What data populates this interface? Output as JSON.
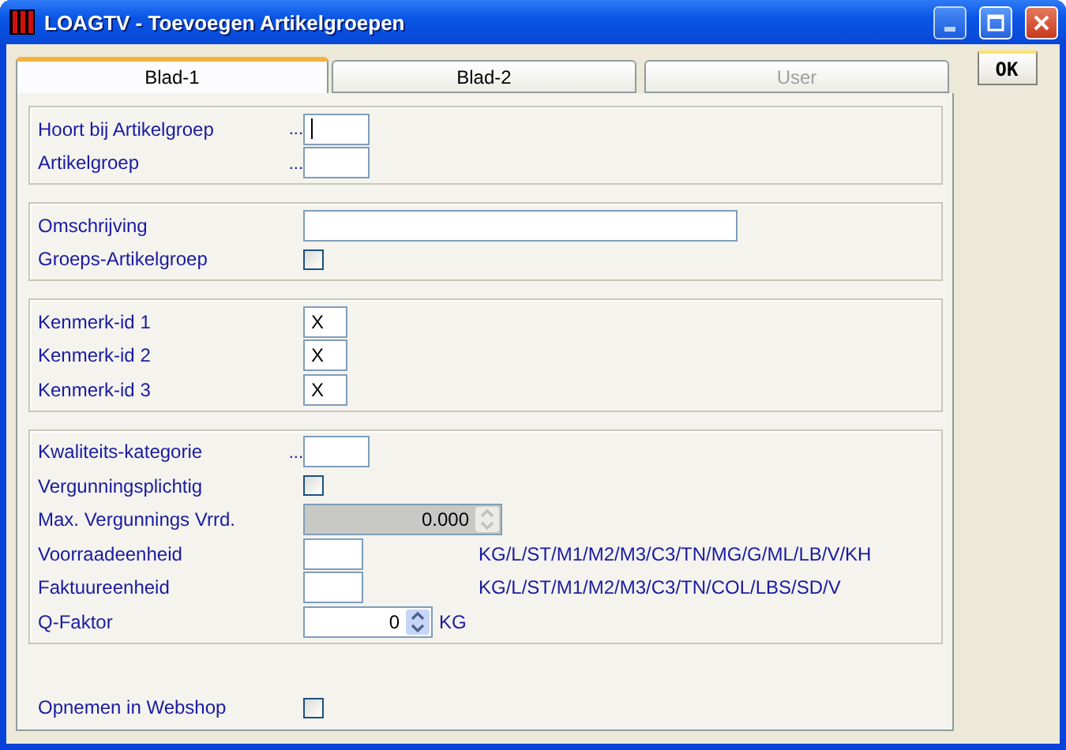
{
  "window": {
    "title": "LOAGTV - Toevoegen Artikelgroepen"
  },
  "tabs": [
    {
      "label": "Blad-1",
      "selected": true,
      "disabled": false
    },
    {
      "label": "Blad-2",
      "selected": false,
      "disabled": false
    },
    {
      "label": "User",
      "selected": false,
      "disabled": true
    }
  ],
  "ok_button": "OK",
  "sections": [
    {
      "framed": true,
      "rows": [
        {
          "kind": "lookup",
          "label": "Hoort bij Artikelgroep",
          "dots": "...",
          "focused": true
        },
        {
          "kind": "lookup",
          "label": "Artikelgroep",
          "dots": "...",
          "focused": false
        }
      ]
    },
    {
      "framed": true,
      "rows": [
        {
          "kind": "text",
          "label": "Omschrijving"
        },
        {
          "kind": "checkbox",
          "label": "Groeps-Artikelgroep",
          "checked": false
        }
      ]
    },
    {
      "framed": true,
      "rows": [
        {
          "kind": "code",
          "label": "Kenmerk-id 1",
          "value": "X"
        },
        {
          "kind": "code",
          "label": "Kenmerk-id 2",
          "value": "X"
        },
        {
          "kind": "code",
          "label": "Kenmerk-id 3",
          "value": "X"
        }
      ]
    },
    {
      "framed": true,
      "rows": [
        {
          "kind": "lookup",
          "label": "Kwaliteits-kategorie",
          "dots": "...",
          "focused": false
        },
        {
          "kind": "checkbox",
          "label": "Vergunningsplichtig",
          "checked": false
        },
        {
          "kind": "spin",
          "label": "Max. Vergunnings Vrrd.",
          "value": "0.000",
          "disabled": true
        },
        {
          "kind": "unit",
          "label": "Voorraadeenheid",
          "hint": "KG/L/ST/M1/M2/M3/C3/TN/MG/G/ML/LB/V/KH"
        },
        {
          "kind": "unit",
          "label": "Faktuureenheid",
          "hint": "KG/L/ST/M1/M2/M3/C3/TN/COL/LBS/SD/V"
        },
        {
          "kind": "spin",
          "label": "Q-Faktor",
          "value": "0",
          "disabled": false,
          "unit": "KG"
        }
      ]
    },
    {
      "framed": false,
      "rows": [
        {
          "kind": "checkbox",
          "label": "Opnemen in Webshop",
          "checked": false
        }
      ]
    }
  ]
}
